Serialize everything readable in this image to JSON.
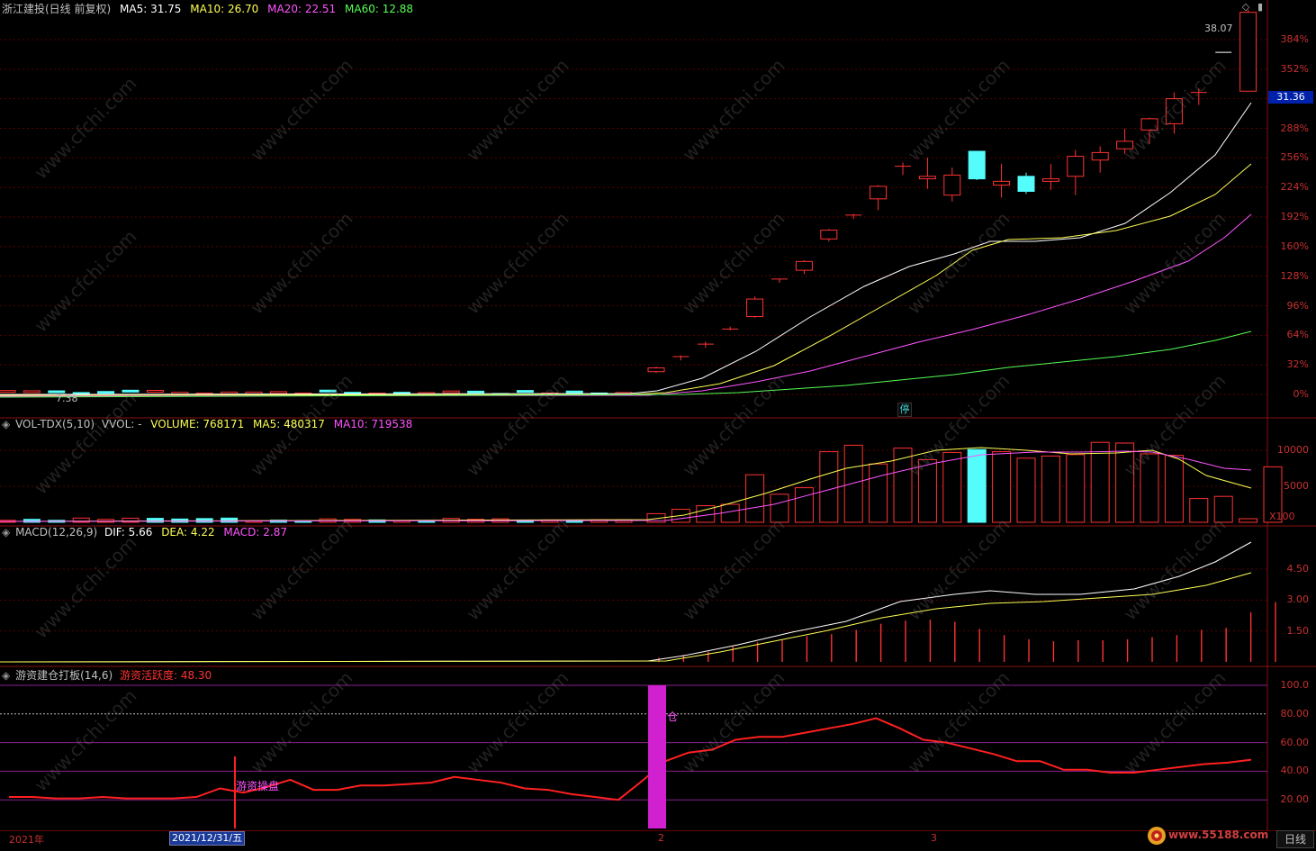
{
  "header": {
    "title": "浙江建投(日线 前复权)",
    "ma5": "MA5: 31.75",
    "ma10": "MA10: 26.70",
    "ma20": "MA20: 22.51",
    "ma60": "MA60: 12.88"
  },
  "price_axis": [
    "384%",
    "352%",
    "288%",
    "256%",
    "224%",
    "192%",
    "160%",
    "128%",
    "96%",
    "64%",
    "32%",
    "0%"
  ],
  "current_price": "31.36",
  "max_price_label": "38.07",
  "min_price_label": "7.38",
  "stop_badge": "停",
  "vol_header": {
    "name": "VOL-TDX(5,10)",
    "wvol": "VVOL: -",
    "volume": "VOLUME: 768171",
    "ma5": "MA5: 480317",
    "ma10": "MA10: 719538"
  },
  "vol_axis": [
    "10000",
    "5000"
  ],
  "vol_unit": "X100",
  "macd_header": {
    "name": "MACD(12,26,9)",
    "dif": "DIF: 5.66",
    "dea": "DEA: 4.22",
    "macd": "MACD: 2.87"
  },
  "macd_axis": [
    "4.50",
    "3.00",
    "1.50"
  ],
  "ind_header": {
    "name": "游资建仓打板(14,6)",
    "value": "游资活跃度: 48.30"
  },
  "ind_axis": [
    "100.0",
    "80.00",
    "60.00",
    "40.00",
    "20.00"
  ],
  "signals": {
    "left": "游资操盘",
    "right": "仓"
  },
  "x_axis": {
    "year": "2021年",
    "cursor_date": "2021/12/31/五",
    "m2": "2",
    "m3": "3"
  },
  "period": "日线",
  "watermark": "www.cfchi.com",
  "logo_text": "www.55188.com",
  "colors": {
    "up": "#ff3232",
    "down": "#54fcfc",
    "ma5": "#ffffff",
    "ma10": "#ffff54",
    "ma20": "#ff54ff",
    "ma60": "#54ff54",
    "axis": "#c83030"
  },
  "chart_data": [
    {
      "type": "candlestick",
      "title": "浙江建投(日线 前复权)",
      "ohlc_recent": [
        [
          9.2,
          9.6,
          9.1,
          9.5
        ],
        [
          10.4,
          10.5,
          10.1,
          10.4
        ],
        [
          11.4,
          11.6,
          11.1,
          11.4
        ],
        [
          12.6,
          12.8,
          12.5,
          12.6
        ],
        [
          13.6,
          15.2,
          13.5,
          15.0
        ],
        [
          16.6,
          16.6,
          16.3,
          16.6
        ],
        [
          17.3,
          18.1,
          17.0,
          18.0
        ],
        [
          19.8,
          20.6,
          19.6,
          20.5
        ],
        [
          21.7,
          21.8,
          21.4,
          21.7
        ],
        [
          23.0,
          24.1,
          22.1,
          24.0
        ],
        [
          25.6,
          25.9,
          24.9,
          25.6
        ],
        [
          24.6,
          26.3,
          23.8,
          24.8
        ],
        [
          23.3,
          25.5,
          22.8,
          24.9
        ],
        [
          26.8,
          26.8,
          24.5,
          24.6
        ],
        [
          24.1,
          25.8,
          23.1,
          24.4
        ],
        [
          24.8,
          25.1,
          23.4,
          23.6
        ],
        [
          24.4,
          25.8,
          23.7,
          24.6
        ],
        [
          24.8,
          26.9,
          23.3,
          26.4
        ],
        [
          26.1,
          27.2,
          25.1,
          26.7
        ],
        [
          27.0,
          28.6,
          26.6,
          27.6
        ],
        [
          28.5,
          29.5,
          27.4,
          29.4
        ],
        [
          29.0,
          31.5,
          28.2,
          31.0
        ],
        [
          31.5,
          31.8,
          30.5,
          31.5
        ],
        [
          34.7,
          34.7,
          34.7,
          34.7
        ],
        [
          31.6,
          38.1,
          31.6,
          37.9
        ]
      ],
      "ma5": 31.75,
      "ma10": 26.7,
      "ma20": 22.51,
      "ma60": 12.88
    },
    {
      "type": "bar",
      "title": "VOL-TDX(5,10)",
      "values_x100": [
        1200,
        1800,
        2300,
        2500,
        6600,
        3900,
        4800,
        9800,
        10700,
        8100,
        10300,
        8700,
        9700,
        10100,
        9800,
        8900,
        9200,
        9400,
        11100,
        11000,
        9500,
        9300,
        3300,
        3600,
        500,
        7700
      ],
      "volume": 768171,
      "ma5": 480317,
      "ma10": 719538
    },
    {
      "type": "line",
      "title": "MACD(12,26,9)",
      "dif": 5.66,
      "dea": 4.22,
      "macd": 2.87
    },
    {
      "type": "line",
      "title": "游资建仓打板(14,6)",
      "value": 48.3,
      "series": [
        {
          "name": "游资活跃度",
          "values": [
            22,
            22,
            21,
            21,
            22,
            21,
            21,
            21,
            22,
            28,
            25,
            29,
            34,
            27,
            27,
            30,
            30,
            31,
            32,
            36,
            34,
            32,
            28,
            27,
            24,
            22,
            20,
            33,
            47,
            53,
            55,
            62,
            64,
            64,
            67,
            70,
            73,
            77,
            70,
            62,
            60,
            56,
            52,
            47,
            47,
            41,
            41,
            39,
            39,
            41,
            43,
            45,
            46,
            48
          ]
        }
      ]
    }
  ]
}
